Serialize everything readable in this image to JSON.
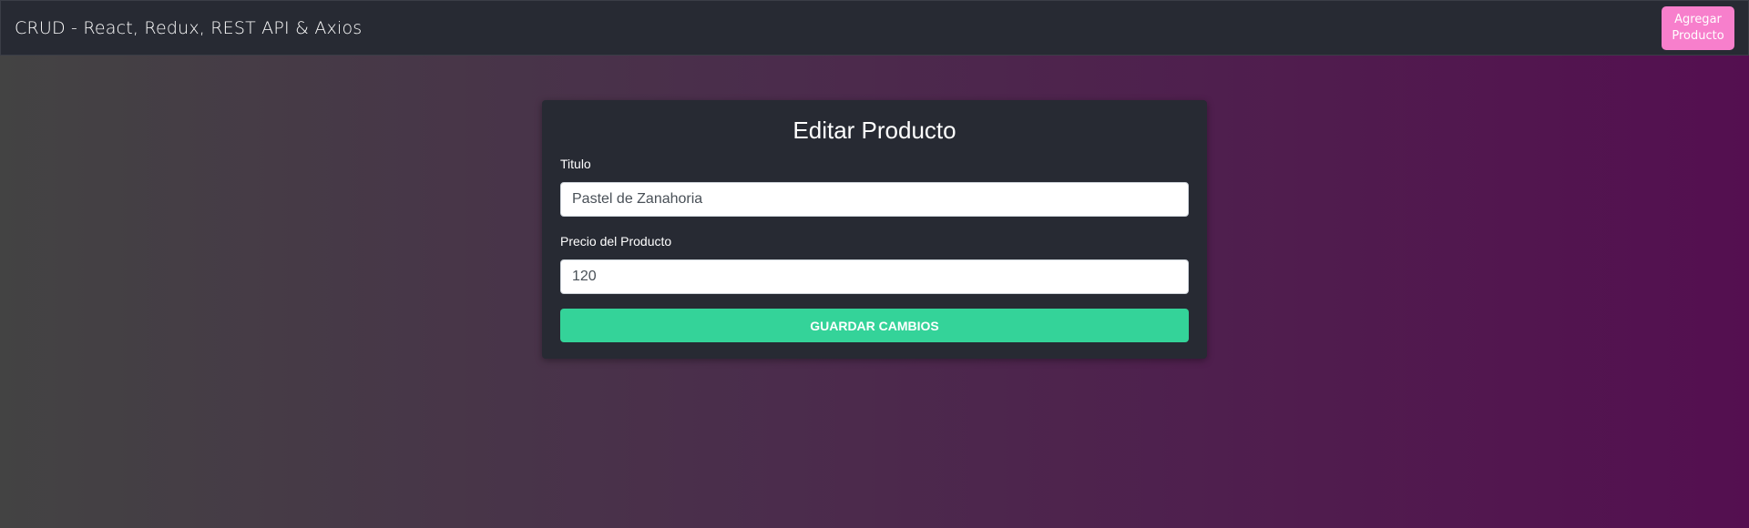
{
  "navbar": {
    "brand": "CRUD - React, Redux, REST API & Axios",
    "add_button_label": "Agregar Producto"
  },
  "form": {
    "title": "Editar Producto",
    "name_label": "Titulo",
    "name_value": "Pastel de Zanahoria",
    "price_label": "Precio del Producto",
    "price_value": "120",
    "submit_label": "GUARDAR CAMBIOS"
  },
  "colors": {
    "navbar_bg": "#272a33",
    "accent_pink": "#f77fcc",
    "accent_green": "#34d399",
    "gradient_start": "#434343",
    "gradient_end": "#540f50"
  }
}
